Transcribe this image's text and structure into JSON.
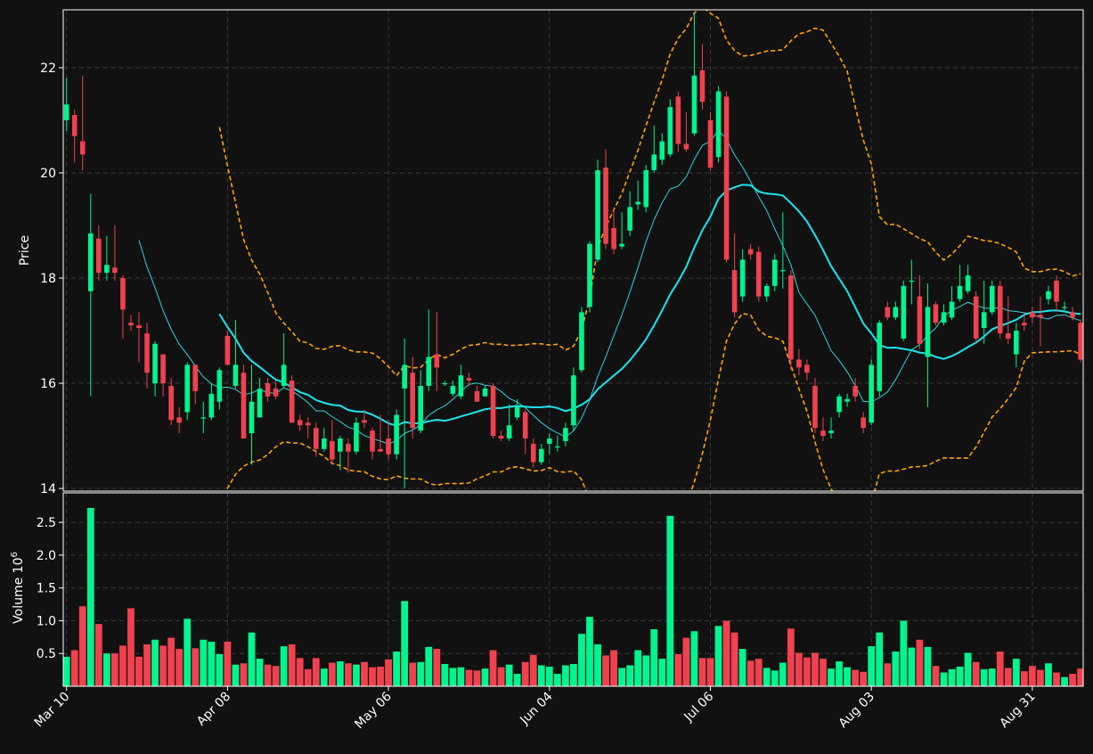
{
  "colors": {
    "background": "#111111",
    "frame": "#ffffff",
    "grid": "#3a3a3a",
    "text": "#ffffff",
    "up": "#00f58f",
    "down": "#f0414f",
    "ma_long": "#19e6f0",
    "ma_short": "#2fd3d9",
    "band": "#ffa500"
  },
  "chart_data": {
    "type": "candlestick",
    "price_panel": {
      "ylabel": "Price",
      "ylim": [
        13.95,
        23.1
      ],
      "yticks": [
        14,
        16,
        18,
        20,
        22
      ]
    },
    "volume_panel": {
      "ylabel": "Volume",
      "ylabel_exponent": "10",
      "ylabel_exponent_power": "6",
      "ylim": [
        0,
        2.95
      ],
      "yticks": [
        0.5,
        1.0,
        1.5,
        2.0,
        2.5
      ],
      "ytick_labels": [
        "0.5",
        "1.0",
        "1.5",
        "2.0",
        "2.5"
      ]
    },
    "x_ticks": [
      {
        "index": 0,
        "label": "Mar 10"
      },
      {
        "index": 20,
        "label": "Apr 08"
      },
      {
        "index": 40,
        "label": "May 06"
      },
      {
        "index": 60,
        "label": "Jun 04"
      },
      {
        "index": 80,
        "label": "Jul 06"
      },
      {
        "index": 100,
        "label": "Aug 03"
      },
      {
        "index": 120,
        "label": "Aug 31"
      }
    ],
    "grid": true,
    "candles": [
      [
        21.0,
        21.3,
        20.8,
        21.8,
        0.45
      ],
      [
        21.1,
        20.7,
        20.2,
        21.2,
        0.55
      ],
      [
        20.6,
        20.35,
        20.05,
        21.85,
        1.22
      ],
      [
        17.75,
        18.85,
        15.75,
        19.6,
        2.72
      ],
      [
        18.75,
        18.1,
        17.95,
        19.0,
        0.95
      ],
      [
        18.1,
        18.25,
        17.95,
        18.8,
        0.5
      ],
      [
        18.2,
        18.1,
        17.95,
        19.0,
        0.5
      ],
      [
        18.0,
        17.4,
        16.85,
        18.05,
        0.62
      ],
      [
        17.15,
        17.1,
        17.0,
        17.3,
        1.19
      ],
      [
        17.1,
        17.05,
        16.4,
        17.35,
        0.45
      ],
      [
        16.95,
        16.2,
        15.9,
        17.15,
        0.64
      ],
      [
        16.0,
        16.75,
        15.75,
        16.8,
        0.71
      ],
      [
        16.55,
        16.0,
        15.75,
        16.55,
        0.62
      ],
      [
        15.95,
        15.3,
        15.2,
        16.1,
        0.74
      ],
      [
        15.35,
        15.25,
        15.05,
        15.55,
        0.57
      ],
      [
        15.45,
        16.35,
        15.3,
        16.4,
        1.03
      ],
      [
        16.35,
        15.85,
        15.6,
        16.35,
        0.58
      ],
      [
        15.35,
        15.35,
        15.05,
        15.65,
        0.71
      ],
      [
        15.35,
        15.8,
        15.3,
        16.0,
        0.68
      ],
      [
        15.65,
        16.25,
        15.5,
        16.3,
        0.49
      ],
      [
        16.9,
        16.35,
        16.35,
        17.0,
        0.68
      ],
      [
        15.95,
        16.35,
        15.9,
        17.2,
        0.33
      ],
      [
        16.2,
        14.95,
        14.95,
        16.35,
        0.35
      ],
      [
        15.05,
        15.65,
        14.45,
        16.35,
        0.82
      ],
      [
        15.35,
        15.9,
        15.35,
        16.1,
        0.42
      ],
      [
        16.0,
        15.75,
        15.65,
        16.1,
        0.33
      ],
      [
        15.9,
        15.75,
        15.7,
        16.05,
        0.31
      ],
      [
        15.95,
        16.35,
        15.9,
        16.95,
        0.61
      ],
      [
        16.05,
        15.25,
        15.25,
        16.15,
        0.64
      ],
      [
        15.3,
        15.2,
        15.1,
        15.4,
        0.43
      ],
      [
        15.25,
        15.2,
        14.95,
        15.35,
        0.26
      ],
      [
        15.15,
        14.75,
        14.6,
        15.25,
        0.43
      ],
      [
        14.75,
        14.95,
        14.7,
        15.15,
        0.27
      ],
      [
        14.9,
        14.55,
        14.45,
        15.3,
        0.36
      ],
      [
        14.7,
        14.95,
        14.35,
        15.0,
        0.38
      ],
      [
        14.85,
        14.7,
        14.3,
        14.95,
        0.35
      ],
      [
        14.7,
        15.25,
        14.65,
        15.35,
        0.33
      ],
      [
        15.3,
        15.25,
        15.15,
        15.5,
        0.37
      ],
      [
        15.1,
        14.7,
        14.55,
        15.15,
        0.29
      ],
      [
        14.75,
        14.7,
        14.7,
        15.4,
        0.3
      ],
      [
        14.95,
        14.65,
        14.55,
        15.3,
        0.41
      ],
      [
        14.65,
        15.4,
        14.55,
        15.5,
        0.53
      ],
      [
        15.9,
        16.35,
        14.0,
        16.85,
        1.3
      ],
      [
        16.2,
        15.15,
        14.95,
        16.5,
        0.36
      ],
      [
        15.1,
        15.95,
        15.05,
        16.25,
        0.37
      ],
      [
        15.95,
        16.5,
        15.85,
        17.4,
        0.6
      ],
      [
        16.55,
        16.3,
        15.85,
        17.35,
        0.57
      ],
      [
        16.0,
        16.0,
        15.95,
        16.05,
        0.34
      ],
      [
        15.8,
        15.95,
        15.75,
        16.05,
        0.28
      ],
      [
        15.75,
        16.15,
        15.7,
        16.35,
        0.29
      ],
      [
        16.1,
        16.05,
        15.95,
        16.2,
        0.25
      ],
      [
        15.85,
        15.65,
        15.65,
        15.95,
        0.24
      ],
      [
        15.75,
        15.9,
        15.75,
        15.95,
        0.27
      ],
      [
        15.95,
        15.0,
        14.95,
        16.0,
        0.55
      ],
      [
        15.0,
        14.95,
        14.9,
        15.1,
        0.29
      ],
      [
        14.95,
        15.2,
        14.9,
        15.6,
        0.33
      ],
      [
        15.35,
        15.55,
        15.3,
        15.7,
        0.19
      ],
      [
        15.45,
        14.95,
        14.65,
        15.5,
        0.37
      ],
      [
        14.85,
        14.5,
        14.4,
        14.95,
        0.48
      ],
      [
        14.5,
        14.75,
        14.45,
        14.85,
        0.32
      ],
      [
        14.85,
        14.95,
        14.65,
        15.05,
        0.3
      ],
      [
        14.8,
        14.8,
        14.7,
        15.0,
        0.19
      ],
      [
        14.9,
        15.15,
        14.8,
        15.25,
        0.32
      ],
      [
        15.2,
        16.15,
        15.1,
        16.3,
        0.34
      ],
      [
        16.25,
        17.35,
        16.2,
        17.45,
        0.8
      ],
      [
        17.45,
        18.65,
        17.35,
        18.7,
        1.06
      ],
      [
        18.35,
        20.05,
        18.3,
        20.25,
        0.64
      ],
      [
        20.1,
        18.65,
        18.55,
        20.45,
        0.47
      ],
      [
        18.95,
        18.55,
        18.45,
        19.35,
        0.55
      ],
      [
        18.6,
        18.65,
        18.55,
        19.25,
        0.28
      ],
      [
        18.9,
        19.35,
        18.8,
        19.65,
        0.32
      ],
      [
        19.4,
        19.45,
        19.3,
        19.85,
        0.55
      ],
      [
        19.35,
        20.05,
        19.25,
        20.15,
        0.47
      ],
      [
        20.05,
        20.35,
        20.0,
        20.9,
        0.87
      ],
      [
        20.25,
        20.6,
        20.15,
        20.75,
        0.42
      ],
      [
        20.35,
        21.25,
        20.3,
        21.4,
        2.6
      ],
      [
        21.45,
        20.55,
        20.4,
        21.55,
        0.49
      ],
      [
        20.55,
        20.45,
        20.4,
        21.15,
        0.74
      ],
      [
        20.75,
        21.85,
        20.7,
        23.05,
        0.84
      ],
      [
        21.95,
        21.35,
        21.2,
        22.45,
        0.43
      ],
      [
        21.0,
        20.1,
        20.05,
        21.15,
        0.43
      ],
      [
        20.3,
        21.55,
        20.2,
        21.65,
        0.92
      ],
      [
        21.45,
        18.35,
        18.3,
        21.55,
        1.0
      ],
      [
        18.15,
        17.35,
        17.25,
        18.85,
        0.82
      ],
      [
        17.65,
        18.35,
        17.55,
        18.55,
        0.57
      ],
      [
        18.55,
        18.45,
        18.35,
        18.65,
        0.39
      ],
      [
        18.5,
        17.65,
        17.55,
        18.6,
        0.42
      ],
      [
        17.65,
        17.85,
        17.55,
        17.9,
        0.28
      ],
      [
        17.85,
        18.35,
        17.75,
        18.45,
        0.24
      ],
      [
        18.15,
        18.15,
        17.8,
        19.25,
        0.36
      ],
      [
        18.05,
        16.45,
        16.25,
        18.15,
        0.88
      ],
      [
        16.45,
        16.3,
        16.15,
        16.65,
        0.51
      ],
      [
        16.35,
        16.2,
        16.05,
        16.45,
        0.44
      ],
      [
        15.95,
        15.15,
        15.05,
        16.1,
        0.51
      ],
      [
        15.1,
        15.0,
        14.9,
        15.35,
        0.42
      ],
      [
        15.05,
        15.1,
        14.95,
        15.35,
        0.27
      ],
      [
        15.45,
        15.75,
        15.35,
        15.8,
        0.38
      ],
      [
        15.65,
        15.7,
        15.55,
        15.8,
        0.29
      ],
      [
        15.95,
        15.75,
        15.65,
        16.1,
        0.25
      ],
      [
        15.35,
        15.15,
        15.05,
        15.45,
        0.22
      ],
      [
        15.25,
        16.35,
        15.2,
        16.45,
        0.61
      ],
      [
        15.85,
        17.15,
        15.75,
        17.2,
        0.82
      ],
      [
        17.45,
        17.25,
        17.2,
        17.55,
        0.35
      ],
      [
        17.25,
        17.45,
        17.2,
        17.55,
        0.53
      ],
      [
        16.85,
        17.85,
        16.8,
        17.95,
        1.0
      ],
      [
        17.95,
        17.95,
        17.5,
        18.35,
        0.59
      ],
      [
        17.65,
        16.75,
        16.65,
        18.05,
        0.71
      ],
      [
        16.5,
        17.45,
        15.55,
        17.9,
        0.6
      ],
      [
        17.5,
        17.15,
        17.1,
        17.55,
        0.31
      ],
      [
        17.15,
        17.35,
        17.1,
        17.5,
        0.21
      ],
      [
        17.25,
        17.55,
        17.2,
        17.85,
        0.26
      ],
      [
        17.6,
        17.85,
        17.55,
        18.25,
        0.3
      ],
      [
        17.75,
        18.05,
        17.7,
        18.25,
        0.51
      ],
      [
        17.65,
        16.85,
        16.75,
        17.75,
        0.37
      ],
      [
        17.05,
        17.35,
        16.75,
        17.95,
        0.26
      ],
      [
        17.35,
        17.85,
        17.3,
        17.95,
        0.27
      ],
      [
        17.85,
        16.95,
        16.85,
        17.95,
        0.53
      ],
      [
        16.95,
        16.85,
        16.75,
        17.65,
        0.28
      ],
      [
        16.55,
        17.0,
        16.3,
        17.15,
        0.42
      ],
      [
        17.15,
        17.1,
        17.0,
        17.35,
        0.23
      ],
      [
        17.35,
        17.25,
        17.15,
        17.45,
        0.31
      ],
      [
        17.3,
        17.25,
        16.7,
        17.65,
        0.25
      ],
      [
        17.6,
        17.75,
        17.5,
        17.85,
        0.35
      ],
      [
        17.95,
        17.55,
        17.35,
        18.05,
        0.21
      ],
      [
        17.45,
        17.45,
        17.35,
        17.55,
        0.14
      ],
      [
        17.35,
        17.25,
        17.2,
        17.45,
        0.19
      ],
      [
        17.15,
        16.45,
        16.4,
        17.2,
        0.27
      ]
    ]
  }
}
